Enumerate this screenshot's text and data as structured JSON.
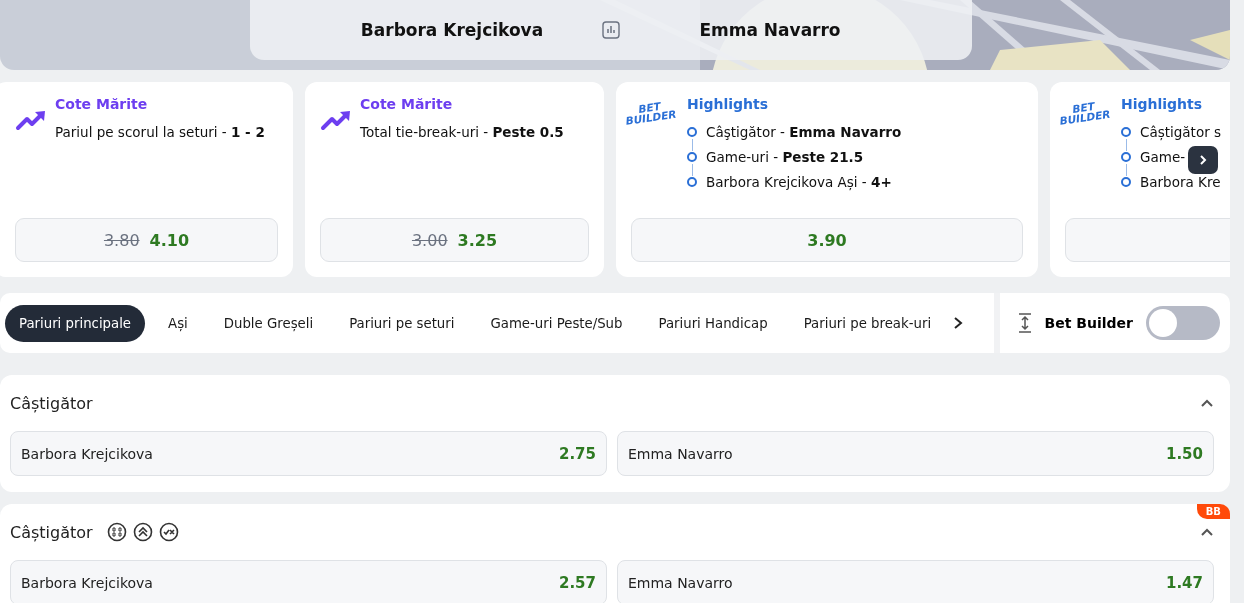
{
  "header": {
    "home": "Barbora Krejcikova",
    "away": "Emma Navarro"
  },
  "promo_cards": [
    {
      "kind": "boosted",
      "title": "Cote Mărite",
      "lines": [
        "Pariul pe scorul la seturi - **1 - 2**"
      ],
      "old_odds": "3.80",
      "odds": "4.10"
    },
    {
      "kind": "boosted",
      "title": "Cote Mărite",
      "lines": [
        "Total tie-break-uri - **Peste 0.5**"
      ],
      "old_odds": "3.00",
      "odds": "3.25"
    },
    {
      "kind": "betbuilder",
      "logo": [
        "BET",
        "BUILDER"
      ],
      "title": "Highlights",
      "lines": [
        "Câştigător - **Emma Navarro**",
        "Game-uri - **Peste 21.5**",
        "Barbora Krejcikova Ași - **4+**"
      ],
      "odds": "3.90"
    },
    {
      "kind": "betbuilder",
      "logo": [
        "BET",
        "BUILDER"
      ],
      "title": "Highlights",
      "lines": [
        "Câștigător s",
        "Game-",
        "Barbora Kre"
      ]
    }
  ],
  "tabs": [
    {
      "label": "Pariuri principale",
      "selected": true
    },
    {
      "label": "Ași",
      "selected": false
    },
    {
      "label": "Duble Greșeli",
      "selected": false
    },
    {
      "label": "Pariuri pe seturi",
      "selected": false
    },
    {
      "label": "Game-uri Peste/Sub",
      "selected": false
    },
    {
      "label": "Pariuri Handicap",
      "selected": false
    },
    {
      "label": "Pariuri pe break-uri",
      "selected": false
    }
  ],
  "bet_builder": {
    "label": "Bet Builder",
    "on": false
  },
  "markets": [
    {
      "title": "Câștigător",
      "icons": false,
      "expanded": true,
      "outcomes": [
        {
          "name": "Barbora Krejcikova",
          "odds": "2.75"
        },
        {
          "name": "Emma Navarro",
          "odds": "1.50"
        }
      ]
    },
    {
      "title": "Câștigător",
      "icons": true,
      "badge": "BB",
      "expanded": true,
      "outcomes": [
        {
          "name": "Barbora Krejcikova",
          "odds": "2.57"
        },
        {
          "name": "Emma Navarro",
          "odds": "1.47"
        }
      ]
    }
  ]
}
